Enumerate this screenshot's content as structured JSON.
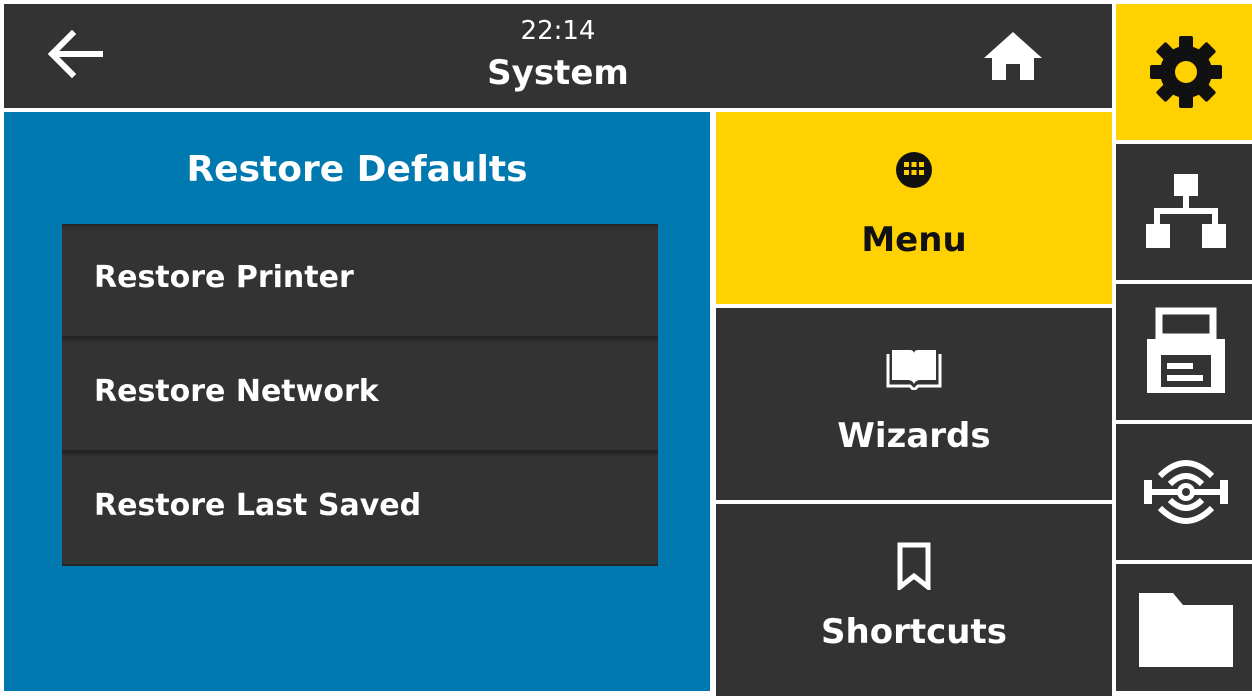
{
  "header": {
    "time": "22:14",
    "title": "System"
  },
  "main": {
    "title": "Restore Defaults",
    "items": [
      {
        "label": "Restore Printer"
      },
      {
        "label": "Restore Network"
      },
      {
        "label": "Restore Last Saved"
      }
    ]
  },
  "panel": {
    "buttons": [
      {
        "label": "Menu",
        "icon": "menu-grid-icon",
        "active": true
      },
      {
        "label": "Wizards",
        "icon": "book-icon",
        "active": false
      },
      {
        "label": "Shortcuts",
        "icon": "bookmark-icon",
        "active": false
      }
    ]
  },
  "rail": {
    "items": [
      {
        "icon": "gear-icon",
        "active": true
      },
      {
        "icon": "network-icon",
        "active": false
      },
      {
        "icon": "printer-icon",
        "active": false
      },
      {
        "icon": "rfid-icon",
        "active": false
      },
      {
        "icon": "folder-icon",
        "active": false
      }
    ]
  },
  "colors": {
    "accent": "#ffd100",
    "primary_blue": "#0079b0",
    "dark_bg": "#333333"
  }
}
